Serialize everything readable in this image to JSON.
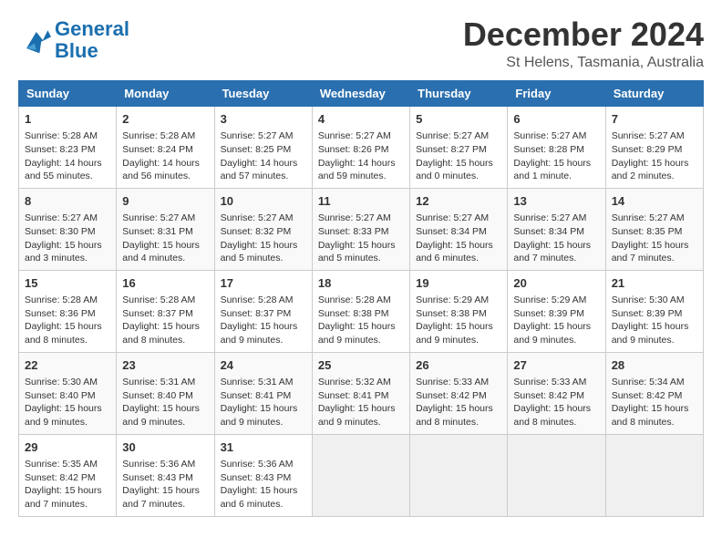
{
  "header": {
    "logo_line1": "General",
    "logo_line2": "Blue",
    "month": "December 2024",
    "location": "St Helens, Tasmania, Australia"
  },
  "weekdays": [
    "Sunday",
    "Monday",
    "Tuesday",
    "Wednesday",
    "Thursday",
    "Friday",
    "Saturday"
  ],
  "weeks": [
    [
      {
        "day": "1",
        "info": "Sunrise: 5:28 AM\nSunset: 8:23 PM\nDaylight: 14 hours\nand 55 minutes."
      },
      {
        "day": "2",
        "info": "Sunrise: 5:28 AM\nSunset: 8:24 PM\nDaylight: 14 hours\nand 56 minutes."
      },
      {
        "day": "3",
        "info": "Sunrise: 5:27 AM\nSunset: 8:25 PM\nDaylight: 14 hours\nand 57 minutes."
      },
      {
        "day": "4",
        "info": "Sunrise: 5:27 AM\nSunset: 8:26 PM\nDaylight: 14 hours\nand 59 minutes."
      },
      {
        "day": "5",
        "info": "Sunrise: 5:27 AM\nSunset: 8:27 PM\nDaylight: 15 hours\nand 0 minutes."
      },
      {
        "day": "6",
        "info": "Sunrise: 5:27 AM\nSunset: 8:28 PM\nDaylight: 15 hours\nand 1 minute."
      },
      {
        "day": "7",
        "info": "Sunrise: 5:27 AM\nSunset: 8:29 PM\nDaylight: 15 hours\nand 2 minutes."
      }
    ],
    [
      {
        "day": "8",
        "info": "Sunrise: 5:27 AM\nSunset: 8:30 PM\nDaylight: 15 hours\nand 3 minutes."
      },
      {
        "day": "9",
        "info": "Sunrise: 5:27 AM\nSunset: 8:31 PM\nDaylight: 15 hours\nand 4 minutes."
      },
      {
        "day": "10",
        "info": "Sunrise: 5:27 AM\nSunset: 8:32 PM\nDaylight: 15 hours\nand 5 minutes."
      },
      {
        "day": "11",
        "info": "Sunrise: 5:27 AM\nSunset: 8:33 PM\nDaylight: 15 hours\nand 5 minutes."
      },
      {
        "day": "12",
        "info": "Sunrise: 5:27 AM\nSunset: 8:34 PM\nDaylight: 15 hours\nand 6 minutes."
      },
      {
        "day": "13",
        "info": "Sunrise: 5:27 AM\nSunset: 8:34 PM\nDaylight: 15 hours\nand 7 minutes."
      },
      {
        "day": "14",
        "info": "Sunrise: 5:27 AM\nSunset: 8:35 PM\nDaylight: 15 hours\nand 7 minutes."
      }
    ],
    [
      {
        "day": "15",
        "info": "Sunrise: 5:28 AM\nSunset: 8:36 PM\nDaylight: 15 hours\nand 8 minutes."
      },
      {
        "day": "16",
        "info": "Sunrise: 5:28 AM\nSunset: 8:37 PM\nDaylight: 15 hours\nand 8 minutes."
      },
      {
        "day": "17",
        "info": "Sunrise: 5:28 AM\nSunset: 8:37 PM\nDaylight: 15 hours\nand 9 minutes."
      },
      {
        "day": "18",
        "info": "Sunrise: 5:28 AM\nSunset: 8:38 PM\nDaylight: 15 hours\nand 9 minutes."
      },
      {
        "day": "19",
        "info": "Sunrise: 5:29 AM\nSunset: 8:38 PM\nDaylight: 15 hours\nand 9 minutes."
      },
      {
        "day": "20",
        "info": "Sunrise: 5:29 AM\nSunset: 8:39 PM\nDaylight: 15 hours\nand 9 minutes."
      },
      {
        "day": "21",
        "info": "Sunrise: 5:30 AM\nSunset: 8:39 PM\nDaylight: 15 hours\nand 9 minutes."
      }
    ],
    [
      {
        "day": "22",
        "info": "Sunrise: 5:30 AM\nSunset: 8:40 PM\nDaylight: 15 hours\nand 9 minutes."
      },
      {
        "day": "23",
        "info": "Sunrise: 5:31 AM\nSunset: 8:40 PM\nDaylight: 15 hours\nand 9 minutes."
      },
      {
        "day": "24",
        "info": "Sunrise: 5:31 AM\nSunset: 8:41 PM\nDaylight: 15 hours\nand 9 minutes."
      },
      {
        "day": "25",
        "info": "Sunrise: 5:32 AM\nSunset: 8:41 PM\nDaylight: 15 hours\nand 9 minutes."
      },
      {
        "day": "26",
        "info": "Sunrise: 5:33 AM\nSunset: 8:42 PM\nDaylight: 15 hours\nand 8 minutes."
      },
      {
        "day": "27",
        "info": "Sunrise: 5:33 AM\nSunset: 8:42 PM\nDaylight: 15 hours\nand 8 minutes."
      },
      {
        "day": "28",
        "info": "Sunrise: 5:34 AM\nSunset: 8:42 PM\nDaylight: 15 hours\nand 8 minutes."
      }
    ],
    [
      {
        "day": "29",
        "info": "Sunrise: 5:35 AM\nSunset: 8:42 PM\nDaylight: 15 hours\nand 7 minutes."
      },
      {
        "day": "30",
        "info": "Sunrise: 5:36 AM\nSunset: 8:43 PM\nDaylight: 15 hours\nand 7 minutes."
      },
      {
        "day": "31",
        "info": "Sunrise: 5:36 AM\nSunset: 8:43 PM\nDaylight: 15 hours\nand 6 minutes."
      },
      null,
      null,
      null,
      null
    ]
  ]
}
